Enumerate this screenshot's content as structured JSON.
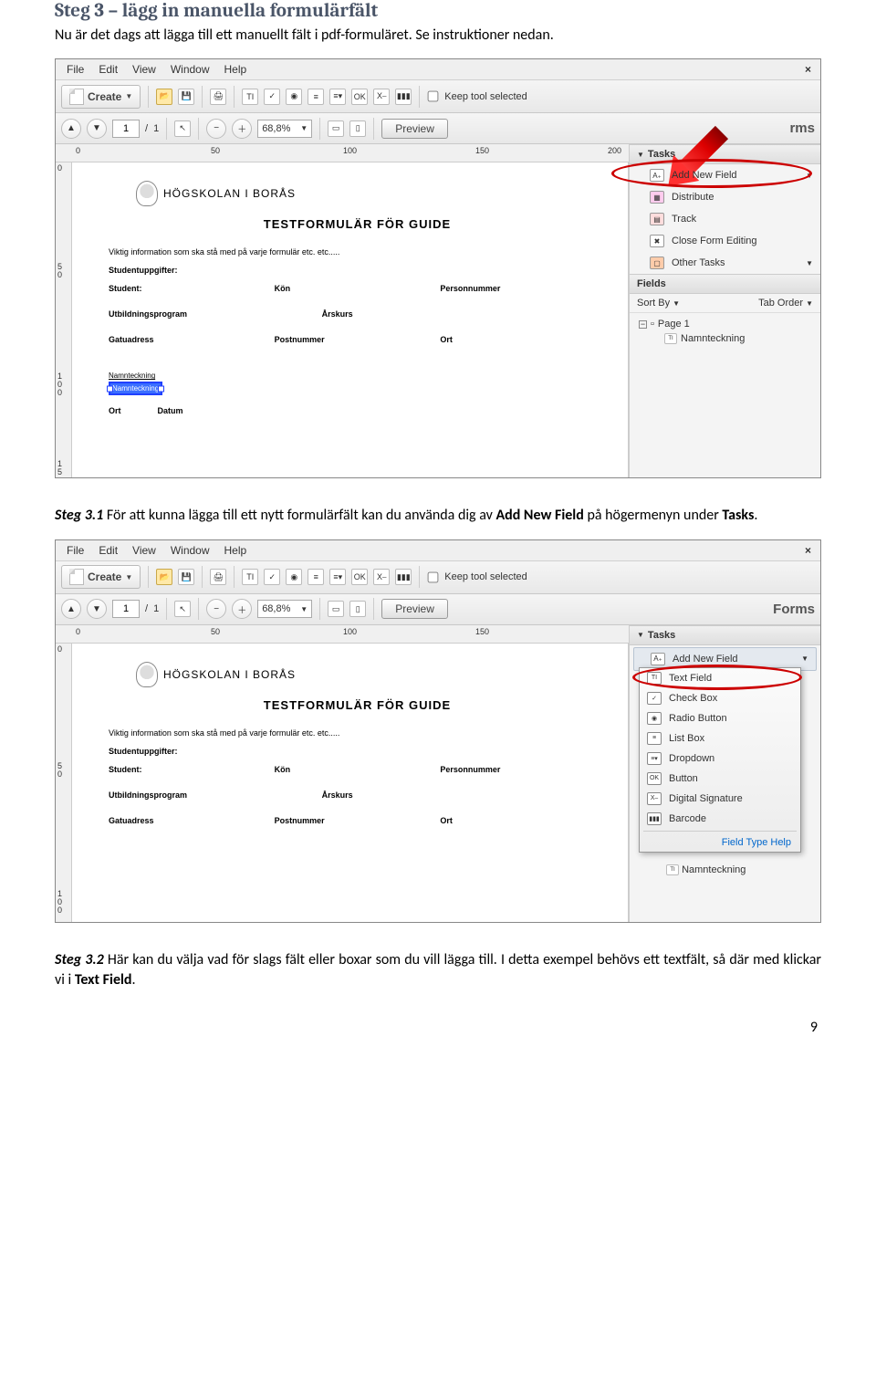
{
  "doc": {
    "heading": "Steg 3 – lägg in manuella formulärfält",
    "intro": "Nu är det dags att lägga till ett manuellt fält i pdf-formuläret. Se instruktioner nedan.",
    "cap1a": "Steg 3.1",
    "cap1b": " För att kunna lägga till ett nytt formulärfält kan du använda dig av ",
    "cap1c": "Add New Field",
    "cap1d": " på högermenyn under ",
    "cap1e": "Tasks",
    "cap1f": ".",
    "cap2a": "Steg 3.2",
    "cap2b": " Här kan du välja vad för slags fält eller boxar som du vill lägga till. I detta exempel behövs ett textfält, så där med klickar vi i ",
    "cap2c": "Text Field",
    "cap2d": ".",
    "pagenum": "9"
  },
  "menu": {
    "file": "File",
    "edit": "Edit",
    "view": "View",
    "window": "Window",
    "help": "Help",
    "close": "×"
  },
  "toolbar": {
    "create": "Create",
    "keep": "Keep tool selected",
    "ti": "TI",
    "ck": "✓",
    "rb": "◉",
    "lb": "≡",
    "dd": "≡▾",
    "ok": "OK",
    "sig": "X⎯",
    "bc": "▮▮▮"
  },
  "pager": {
    "page": "1",
    "sep": "/",
    "total": "1",
    "zoom": "68,8%",
    "preview": "Preview",
    "forms": "Forms",
    "rms": "rms"
  },
  "ruler": {
    "r0": "0",
    "r50": "50",
    "r100": "100",
    "r150": "150",
    "r200": "200",
    "v0": "0",
    "v50": "5\n0",
    "v100": "1\n0\n0",
    "v150": "1\n5"
  },
  "page": {
    "uni": "HÖGSKOLAN I BORÅS",
    "title": "TESTFORMULÄR FÖR GUIDE",
    "info": "Viktig information som ska stå med på varje formulär etc. etc.....",
    "studupp": "Studentuppgifter:",
    "student": "Student:",
    "kon": "Kön",
    "pnr": "Personnummer",
    "utb": "Utbildningsprogram",
    "arskurs": "Årskurs",
    "gata": "Gatuadress",
    "postnr": "Postnummer",
    "ort": "Ort",
    "namnt_lbl": "Namnteckning",
    "namnt_field": "Namnteckning",
    "ort2": "Ort",
    "datum": "Datum"
  },
  "side": {
    "tasks": "Tasks",
    "add": "Add New Field",
    "dist": "Distribute",
    "track": "Track",
    "close": "Close Form Editing",
    "other": "Other Tasks",
    "fields": "Fields",
    "sort": "Sort By",
    "tab": "Tab Order",
    "p1": "Page 1",
    "fld": "Namnteckning"
  },
  "popup": {
    "tf": "Text Field",
    "cb": "Check Box",
    "rb": "Radio Button",
    "lb": "List Box",
    "dd": "Dropdown",
    "btn": "Button",
    "sig": "Digital Signature",
    "bc": "Barcode",
    "help": "Field Type Help",
    "under": "Namnteckning"
  }
}
